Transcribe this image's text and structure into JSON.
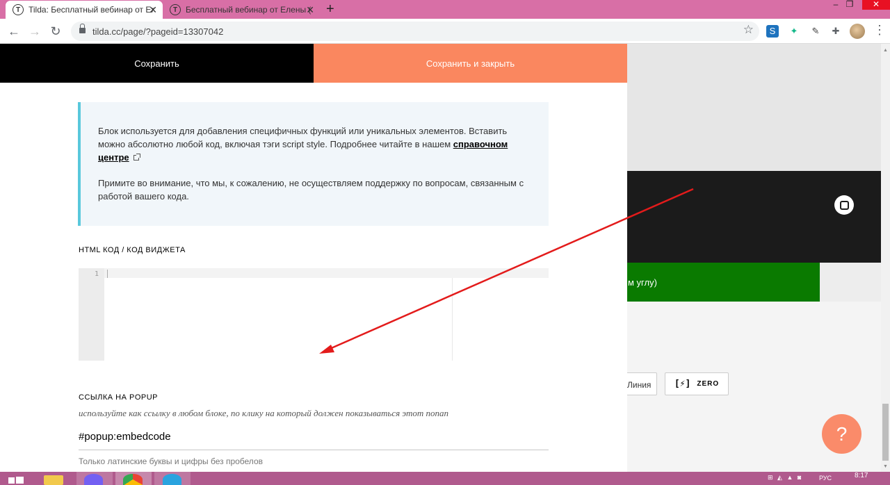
{
  "browser": {
    "tabs": [
      {
        "title": "Tilda: Бесплатный вебинар от Ел",
        "favicon": "T",
        "active": true
      },
      {
        "title": "Бесплатный вебинар от Елены (",
        "favicon": "T",
        "active": false
      }
    ],
    "url": "tilda.cc/page/?pageid=13307042",
    "window_controls": {
      "minimize": "–",
      "maximize": "❐",
      "close": "✕"
    }
  },
  "editor": {
    "save_label": "Сохранить",
    "save_close_label": "Сохранить и закрыть",
    "info": {
      "paragraph1_text": "Блок используется для добавления специфичных функций или уникальных элементов. Вставить можно абсолютно любой код, включая тэги script style. Подробнее читайте в нашем ",
      "paragraph1_link": "справочном центре",
      "paragraph2": "Примите во внимание, что мы, к сожалению, не осуществляем поддержку по вопросам, связанным с работой вашего кода."
    },
    "html_code": {
      "label": "HTML КОД / КОД ВИДЖЕТА",
      "line_number": "1",
      "value": ""
    },
    "popup_link": {
      "label": "ССЫЛКА НА POPUP",
      "hint": "используйте как ссылку в любом блоке, по клику на который должен показываться этот попап",
      "value": "#popup:embedcode",
      "note": "Только латинские буквы и цифры без пробелов"
    }
  },
  "background_page": {
    "green_button_text": "м углу)",
    "liniya_button": "Линия",
    "zero_icon": "[⚡]",
    "zero_button": "ZERO",
    "help_button": "?"
  },
  "taskbar": {
    "tray": "⊞ ◭ ▲ ◙",
    "lang": "РУС",
    "time": "8:17"
  },
  "colors": {
    "tab_strip": "#d86fa6",
    "save_close": "#fa875f",
    "info_border": "#5ac8dc",
    "green_button": "#0a7a00",
    "help_button": "#fa8b6a",
    "arrow": "#e31b1b"
  }
}
